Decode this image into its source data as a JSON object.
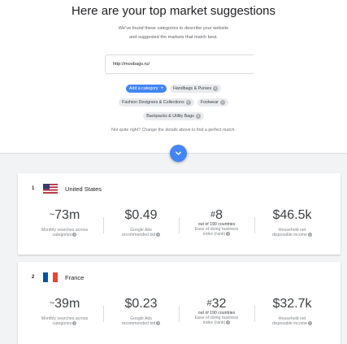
{
  "header": {
    "title": "Here are your top market suggestions",
    "subtitle_line1": "We've found these categories to describe your website",
    "subtitle_line2": "and suggested the markets that match best."
  },
  "url_input": {
    "value": "http://moobags.ru/"
  },
  "categories": {
    "add_label": "Add a category",
    "items": [
      {
        "label": "Handbags & Purses"
      },
      {
        "label": "Fashion Designers & Collections"
      },
      {
        "label": "Footwear"
      },
      {
        "label": "Backpacks & Utility Bags"
      }
    ]
  },
  "hint": "Not quite right? Change the details above to find a perfect match.",
  "expand_icon": "chevron-down-icon",
  "markets": [
    {
      "rank": "1",
      "country": "United States",
      "flag": "us-flag",
      "searches": {
        "prefix": "~",
        "value": "73m",
        "label_line1": "Monthly searches across",
        "label_line2": "categories"
      },
      "bid": {
        "value": "$0.49",
        "label_line1": "Google Ads",
        "label_line2": "recommended bid"
      },
      "ease": {
        "prefix": "#",
        "value": "8",
        "out_of": "out of 190 countries",
        "label_line1": "Ease of doing business",
        "label_line2": "index (rank)"
      },
      "income": {
        "value": "$46.5k",
        "label_line1": "Household net",
        "label_line2": "disposable income"
      }
    },
    {
      "rank": "2",
      "country": "France",
      "flag": "fr-flag",
      "searches": {
        "prefix": "~",
        "value": "39m",
        "label_line1": "Monthly searches across",
        "label_line2": "categories"
      },
      "bid": {
        "value": "$0.23",
        "label_line1": "Google Ads",
        "label_line2": "recommended bid"
      },
      "ease": {
        "prefix": "#",
        "value": "32",
        "out_of": "out of 190 countries",
        "label_line1": "Ease of doing business",
        "label_line2": "index (rank)"
      },
      "income": {
        "value": "$32.7k",
        "label_line1": "Household net",
        "label_line2": "disposable income"
      }
    }
  ],
  "colors": {
    "accent": "#4285f4",
    "chip_bg": "#e8eaed",
    "section_bg": "#f1f3f4"
  }
}
